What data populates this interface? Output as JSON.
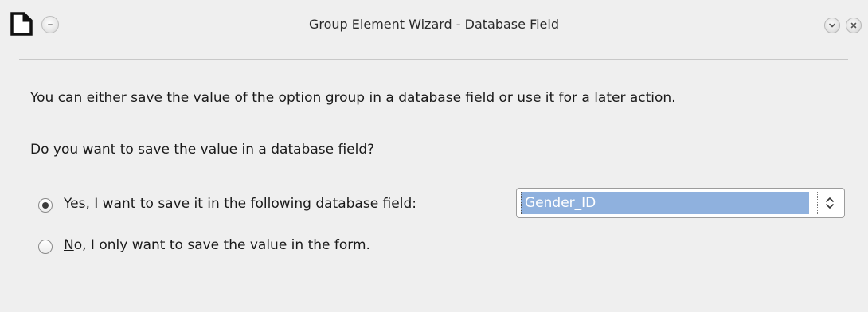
{
  "window": {
    "title": "Group Element Wizard - Database Field"
  },
  "icons": {
    "app": "document-icon",
    "menu": "window-menu-icon",
    "minimize": "chevron-down-icon",
    "close": "close-icon",
    "spin": "up-down-chevron-icon"
  },
  "content": {
    "description": "You can either save the value of the option group in a database field or use it for a later action.",
    "question": "Do you want to save the value in a database field?",
    "options": [
      {
        "mnemonic": "Y",
        "rest": "es, I want to save it in the following database field:",
        "checked": true
      },
      {
        "mnemonic": "N",
        "rest": "o, I only want to save the value in the form.",
        "checked": false
      }
    ],
    "field_select": {
      "value": "Gender_ID"
    }
  },
  "colors": {
    "selection": "#8fb1de",
    "background": "#efefef"
  }
}
